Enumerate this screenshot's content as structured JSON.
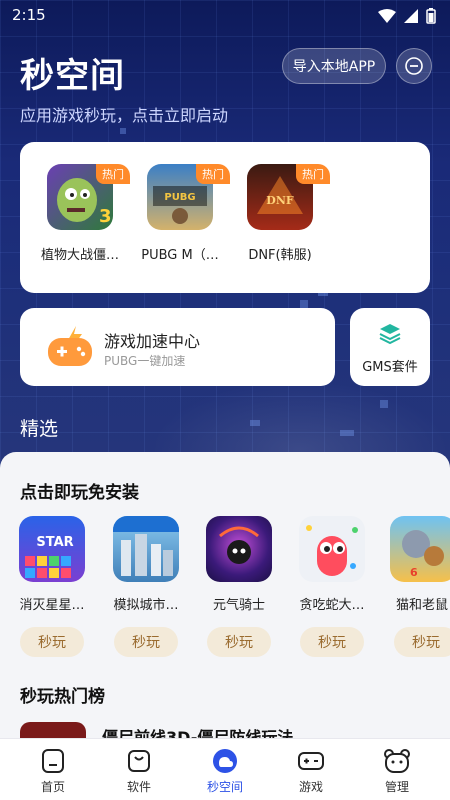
{
  "status_bar": {
    "time": "2:15"
  },
  "header": {
    "title": "秒空间",
    "subtitle": "应用游戏秒玩，点击立即启动",
    "import_button": "导入本地APP"
  },
  "top_games": [
    {
      "name": "植物大战僵…",
      "badge": "热门",
      "icon": "pvz-icon"
    },
    {
      "name": "PUBG M（…",
      "badge": "热门",
      "icon": "pubg-icon"
    },
    {
      "name": "DNF(韩服)",
      "badge": "热门",
      "icon": "dnf-icon"
    }
  ],
  "accel": {
    "title": "游戏加速中心",
    "subtitle": "PUBG一键加速"
  },
  "gms": {
    "label": "GMS套件"
  },
  "section_featured": "精选",
  "instant_play": {
    "title": "点击即玩免安装",
    "button_label": "秒玩",
    "items": [
      {
        "name": "消灭星星…"
      },
      {
        "name": "模拟城市…"
      },
      {
        "name": "元气骑士"
      },
      {
        "name": "贪吃蛇大…"
      },
      {
        "name": "猫和老鼠"
      }
    ]
  },
  "ranking": {
    "title": "秒玩热门榜",
    "first_item": "僵尸前线3D-僵尸防线玩法"
  },
  "bottom_nav": [
    {
      "label": "首页",
      "icon": "home-icon"
    },
    {
      "label": "软件",
      "icon": "bag-icon"
    },
    {
      "label": "秒空间",
      "icon": "cloud-space-icon",
      "active": true
    },
    {
      "label": "游戏",
      "icon": "gamepad-icon"
    },
    {
      "label": "管理",
      "icon": "bear-face-icon"
    }
  ],
  "colors": {
    "accent": "#2d52e6",
    "hot_badge": "#ff8a2a",
    "play_button_bg": "#f3ead9",
    "play_button_text": "#9a6b2f"
  }
}
